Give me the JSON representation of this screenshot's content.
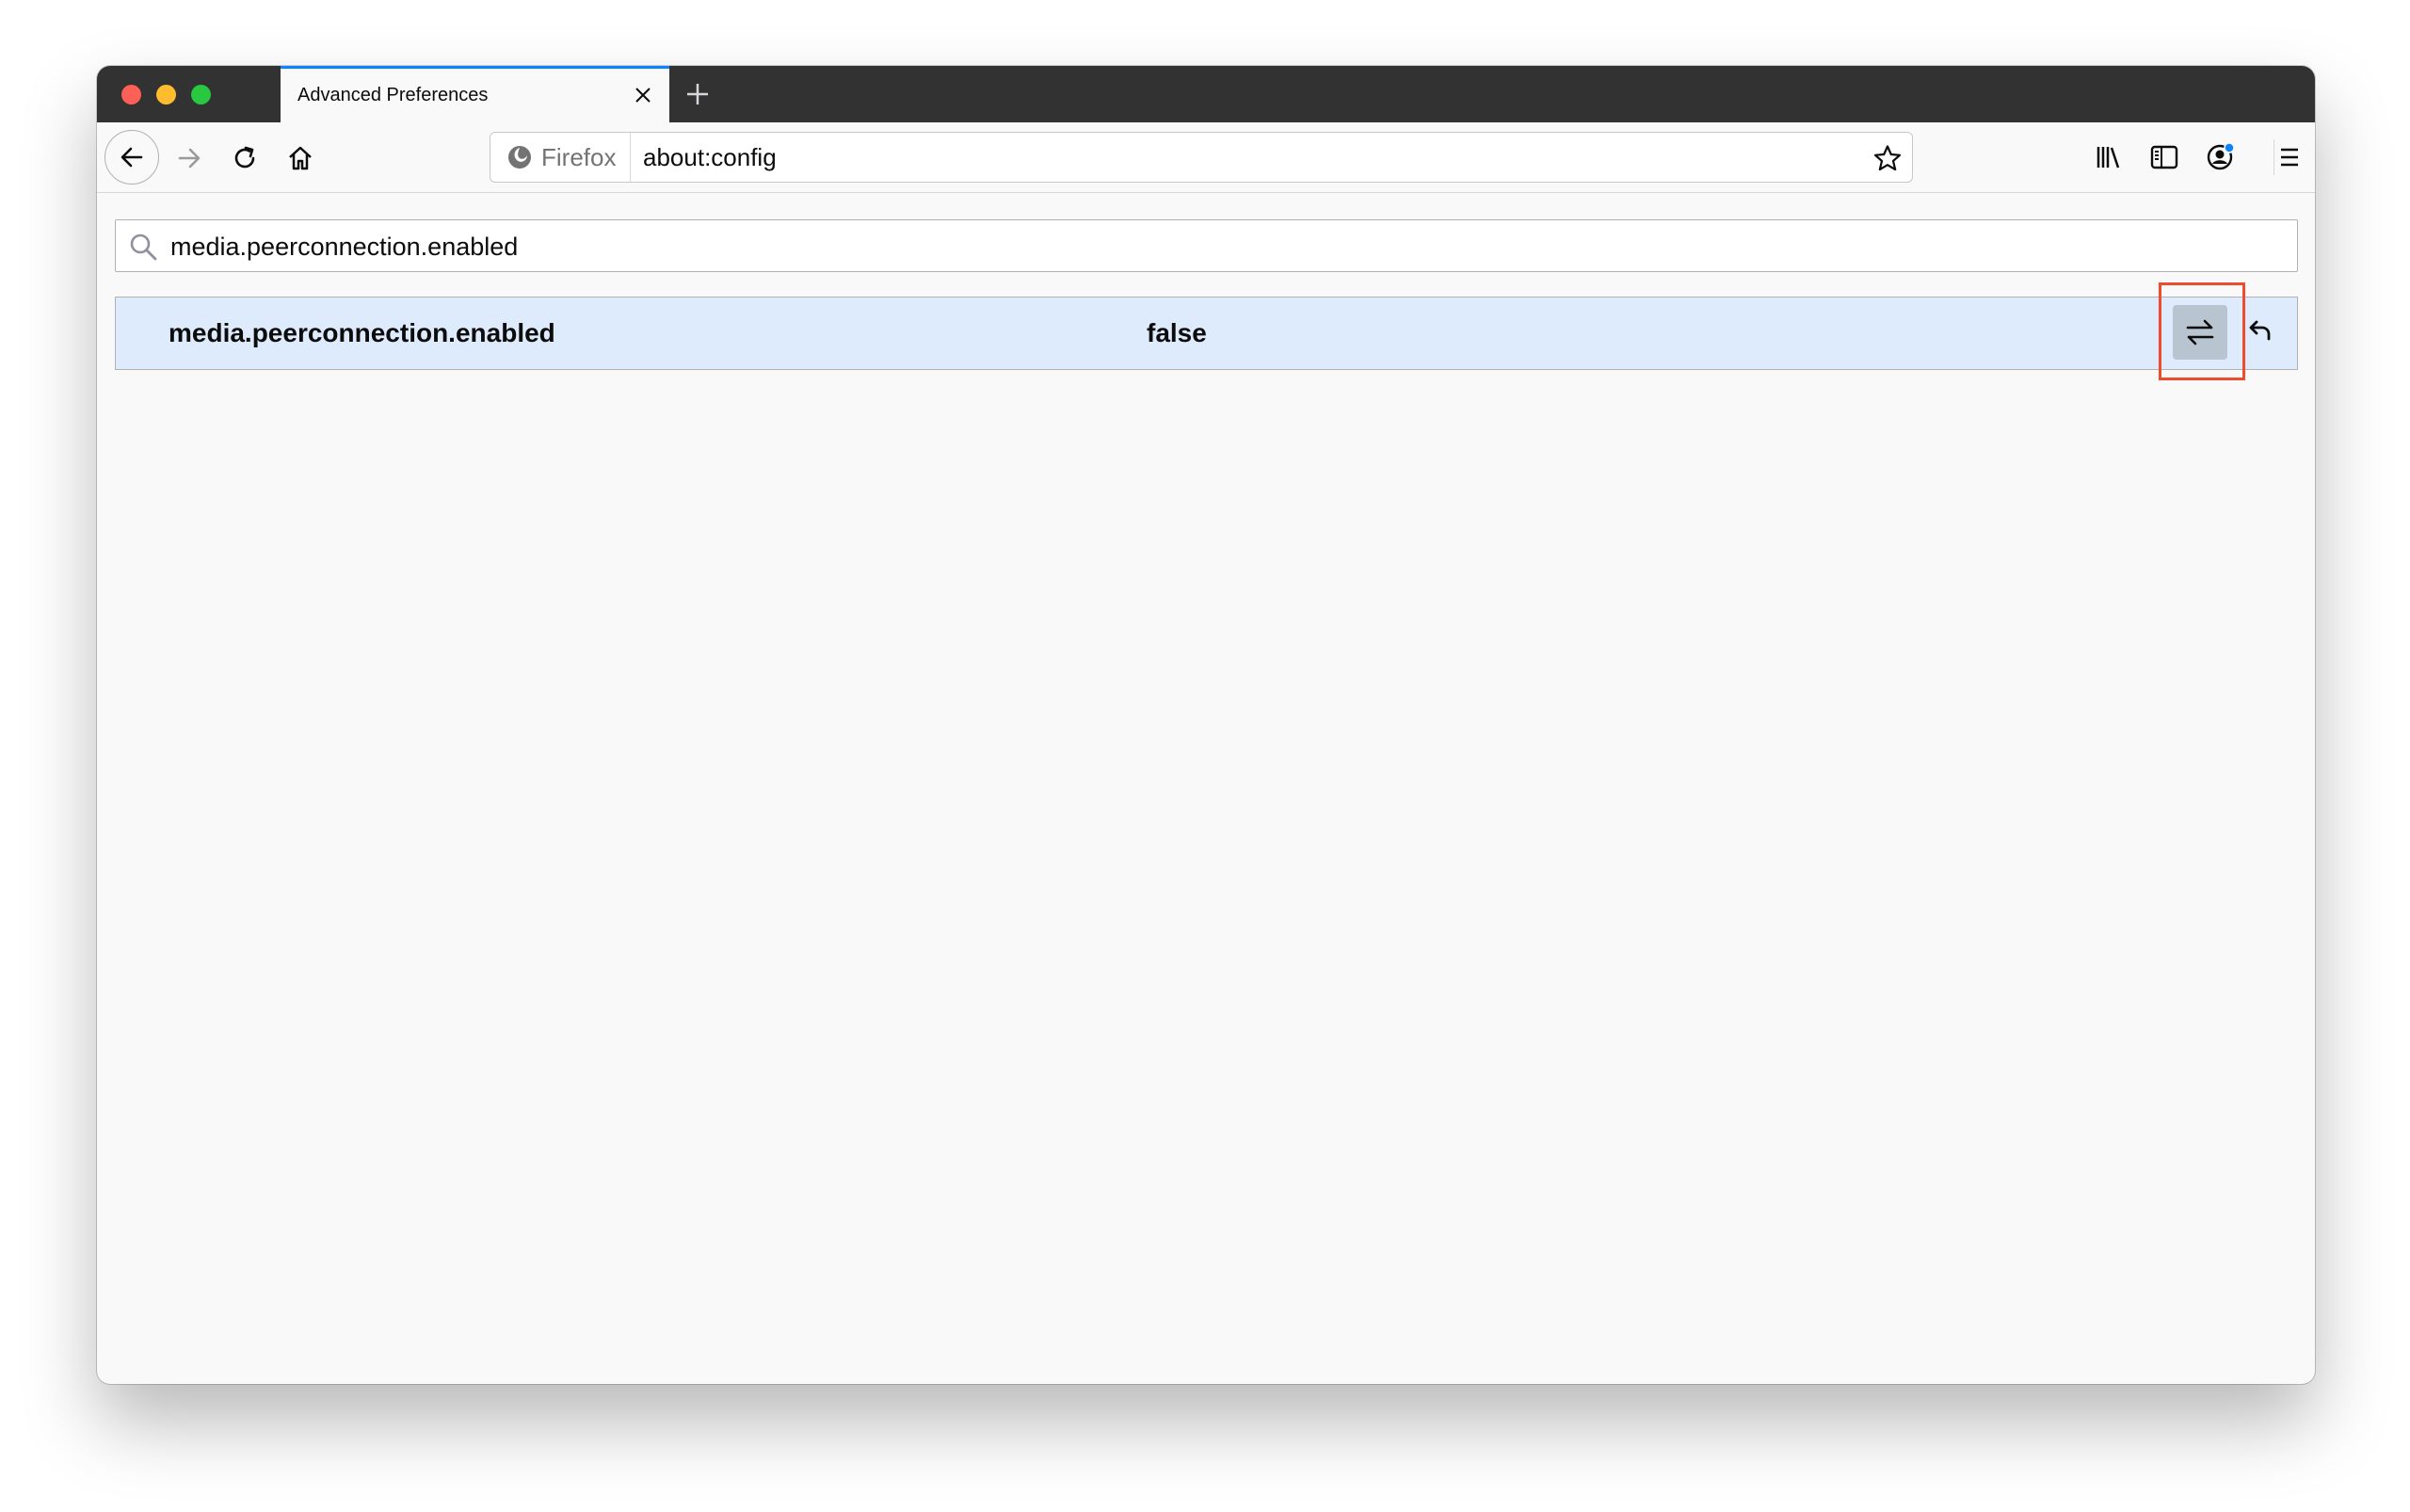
{
  "window": {
    "tab": {
      "title": "Advanced Preferences"
    }
  },
  "navbar": {
    "identity_label": "Firefox",
    "url": "about:config",
    "account_badge_color": "#0a84ff"
  },
  "config": {
    "search_value": "media.peerconnection.enabled",
    "rows": [
      {
        "name": "media.peerconnection.enabled",
        "value": "false"
      }
    ]
  },
  "colors": {
    "accent": "#0a84ff",
    "row_highlight": "#ddebfd",
    "annotation_box": "#ef4b2f"
  },
  "icons": {
    "tab_close": "close-icon",
    "new_tab": "plus-icon",
    "back": "arrow-left-icon",
    "forward": "arrow-right-icon",
    "reload": "reload-icon",
    "home": "home-icon",
    "identity": "firefox-icon",
    "bookmark": "star-icon",
    "library": "library-icon",
    "sidebar": "sidebar-icon",
    "account": "account-icon",
    "menu": "hamburger-menu-icon",
    "search": "search-icon",
    "toggle": "toggle-arrows-icon",
    "reset": "undo-icon"
  }
}
